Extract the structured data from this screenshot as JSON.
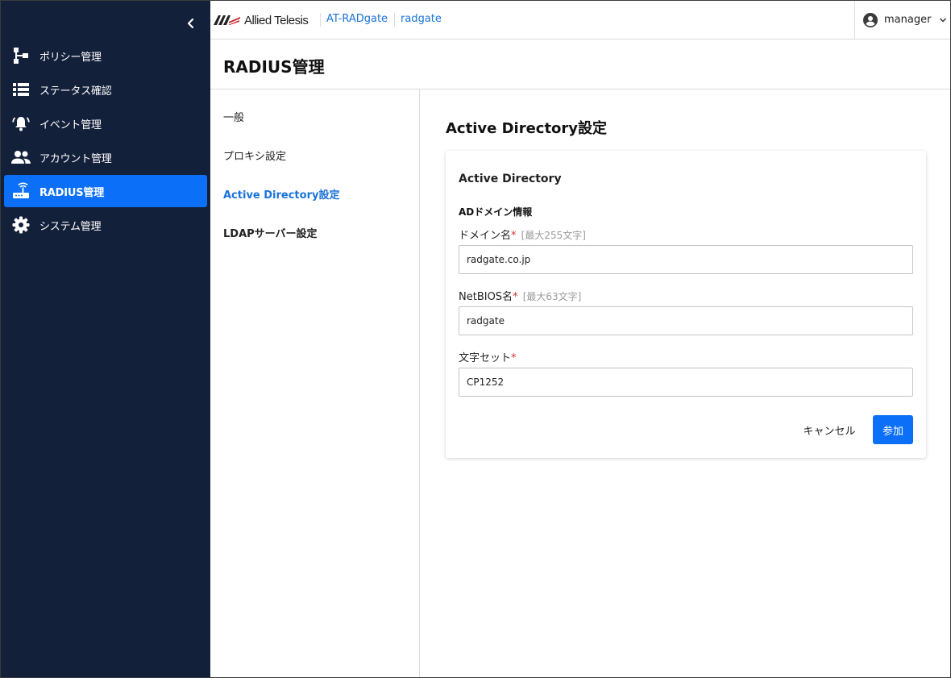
{
  "sidebar": {
    "items": [
      {
        "label": "ポリシー管理",
        "icon": "policy-tree-icon",
        "active": false
      },
      {
        "label": "ステータス確認",
        "icon": "list-icon",
        "active": false
      },
      {
        "label": "イベント管理",
        "icon": "bell-icon",
        "active": false
      },
      {
        "label": "アカウント管理",
        "icon": "people-icon",
        "active": false
      },
      {
        "label": "RADIUS管理",
        "icon": "router-icon",
        "active": true
      },
      {
        "label": "システム管理",
        "icon": "gear-icon",
        "active": false
      }
    ]
  },
  "header": {
    "logo_text": "Allied Telesis",
    "product": "AT-RADgate",
    "host": "radgate",
    "user": "manager"
  },
  "page": {
    "title": "RADIUS管理"
  },
  "subnav": {
    "items": [
      {
        "label": "一般"
      },
      {
        "label": "プロキシ設定"
      },
      {
        "label": "Active Directory設定"
      },
      {
        "label": "LDAPサーバー設定"
      }
    ]
  },
  "content": {
    "section_title": "Active Directory設定",
    "card_title": "Active Directory",
    "group_title": "ADドメイン情報",
    "fields": {
      "domain": {
        "label": "ドメイン名",
        "required": "*",
        "hint": "[最大255文字]",
        "value": "radgate.co.jp"
      },
      "netbios": {
        "label": "NetBIOS名",
        "required": "*",
        "hint": "[最大63文字]",
        "value": "radgate"
      },
      "charset": {
        "label": "文字セット",
        "required": "*",
        "value": "CP1252"
      }
    },
    "buttons": {
      "cancel": "キャンセル",
      "join": "参加"
    }
  },
  "colors": {
    "sidebar_bg": "#13203a",
    "accent": "#0b6ff7",
    "link": "#1a73d9",
    "required": "#d32f2f"
  }
}
